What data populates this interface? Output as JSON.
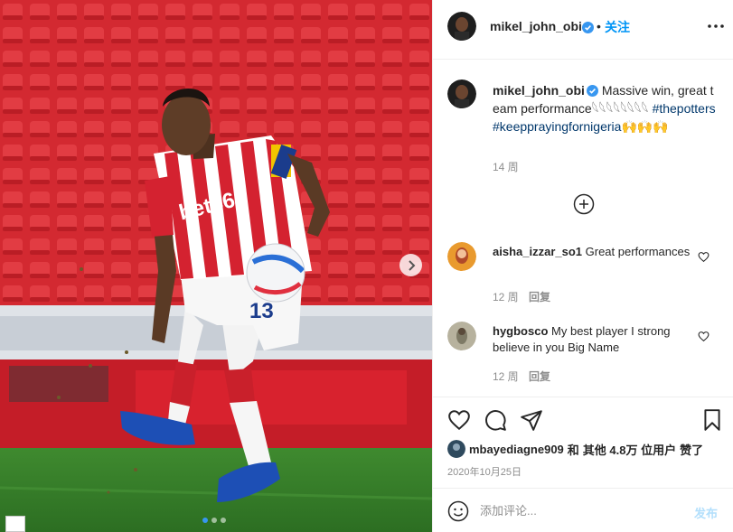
{
  "post": {
    "author": "mikel_john_obi",
    "follow_separator": "•",
    "follow_label": "关注",
    "caption_text": "Massive win, great team performance𓆩𓆩𓆩𓆩𓆩𓆩𓆩𓆩",
    "hashtag_1": "#thepotters",
    "hashtag_2": "#keepprayingfornigeria",
    "caption_emoji_tail": "🙌🙌🙌",
    "caption_time": "14 周",
    "image": {
      "jersey_sponsor": "bet365",
      "shirt_number": "13"
    },
    "carousel": {
      "slide_count": 3,
      "active_index": 0
    }
  },
  "comments": [
    {
      "user": "aisha_izzar_so1",
      "text": "Great performances",
      "time": "12 周",
      "reply_label": "回复"
    },
    {
      "user": "hygbosco",
      "text": "My best player I strong believe in you Big Name",
      "time": "12 周",
      "reply_label": "回复"
    }
  ],
  "likes": {
    "user": "mbayediagne909",
    "conjunction": "和",
    "others": "其他 4.8万 位用户",
    "suffix": "赞了"
  },
  "date": "2020年10月25日",
  "composer": {
    "placeholder": "添加评论...",
    "post_label": "发布"
  },
  "icons": {
    "verified": "verified-badge-icon",
    "more": "more-options-icon",
    "load_more": "plus-circle-icon",
    "heart": "heart-icon",
    "comment": "comment-icon",
    "share": "share-icon",
    "bookmark": "bookmark-icon",
    "emoji": "emoji-icon",
    "next": "chevron-right-icon"
  },
  "colors": {
    "accent": "#0095f6",
    "verified": "#3897f0",
    "hashtag": "#00376b",
    "muted": "#8e8e8e"
  }
}
